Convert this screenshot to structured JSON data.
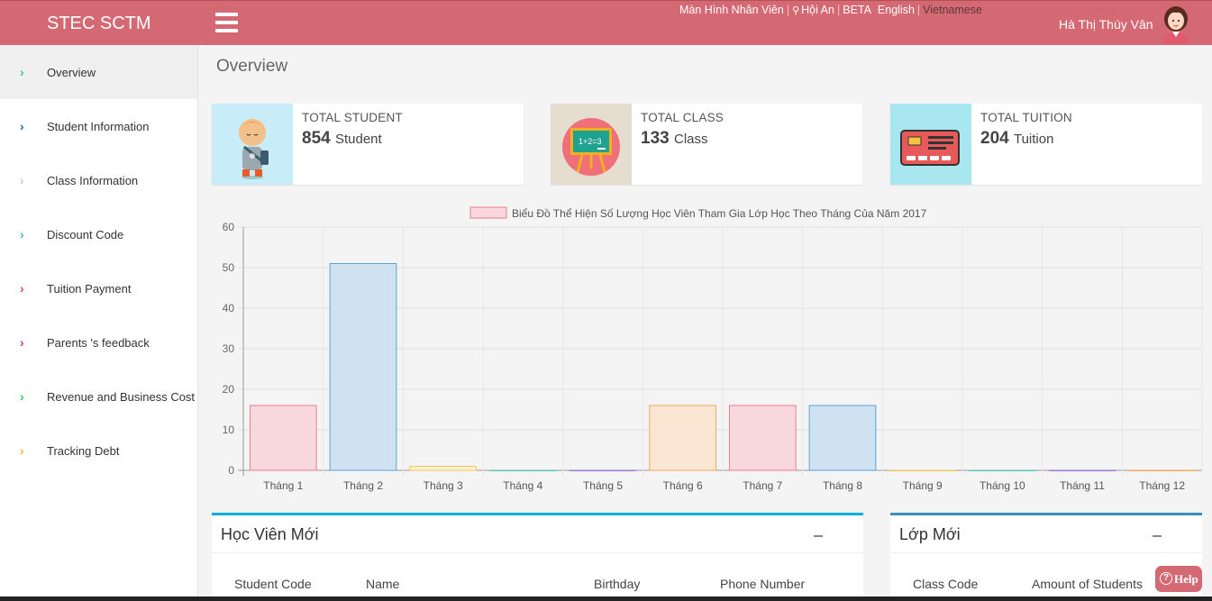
{
  "header": {
    "brand": "STEC SCTM",
    "nav": {
      "screen": "Màn Hình Nhân Viên",
      "location": "Hội An",
      "beta": "BETA",
      "lang_en": "English",
      "lang_vi": "Vietnamese"
    },
    "user_name": "Hà Thị Thúy Vân"
  },
  "sidebar": {
    "items": [
      {
        "label": "Overview",
        "color": "#3bbfb7"
      },
      {
        "label": "Student Information",
        "color": "#2f6fb0"
      },
      {
        "label": "Class Information",
        "color": "#cccccc"
      },
      {
        "label": "Discount Code",
        "color": "#3bbfb7"
      },
      {
        "label": "Tuition Payment",
        "color": "#e0455a"
      },
      {
        "label": "Parents 's feedback",
        "color": "#d6338f"
      },
      {
        "label": "Revenue and Business Cost",
        "color": "#2ecc71"
      },
      {
        "label": "Tracking Debt",
        "color": "#f0c020"
      }
    ]
  },
  "page": {
    "title": "Overview"
  },
  "stats": [
    {
      "label": "TOTAL STUDENT",
      "value": "854",
      "unit": "Student"
    },
    {
      "label": "TOTAL CLASS",
      "value": "133",
      "unit": "Class"
    },
    {
      "label": "TOTAL TUITION",
      "value": "204",
      "unit": "Tuition"
    }
  ],
  "chart_data": {
    "type": "bar",
    "legend": "Biểu Đồ Thể Hiện Số Lượng Học Viên Tham Gia Lớp Học Theo Tháng Của Năm 2017",
    "categories": [
      "Tháng 1",
      "Tháng 2",
      "Tháng 3",
      "Tháng 4",
      "Tháng 5",
      "Tháng 6",
      "Tháng 7",
      "Tháng 8",
      "Tháng 9",
      "Tháng 10",
      "Tháng 11",
      "Tháng 12"
    ],
    "values": [
      16,
      51,
      1,
      0,
      0,
      16,
      16,
      16,
      0,
      0,
      0,
      0
    ],
    "ylim": [
      0,
      60
    ],
    "yticks": [
      0,
      10,
      20,
      30,
      40,
      50,
      60
    ],
    "grid": true,
    "legend_position": "top",
    "colors": [
      {
        "fill": "#f8d7dd",
        "stroke": "#e8808f"
      },
      {
        "fill": "#cfe2f1",
        "stroke": "#5aa2d8"
      },
      {
        "fill": "#fdf2d6",
        "stroke": "#f5c65a"
      },
      {
        "fill": "#d6f1ef",
        "stroke": "#5cc5c0"
      },
      {
        "fill": "#e6dcf6",
        "stroke": "#9c7ad6"
      },
      {
        "fill": "#fbe6d3",
        "stroke": "#f5a95a"
      }
    ]
  },
  "panels": {
    "left": {
      "title": "Học Viên Mới",
      "columns": [
        "Student Code",
        "Name",
        "Birthday",
        "Phone Number"
      ]
    },
    "right": {
      "title": "Lớp Mới",
      "columns": [
        "Class Code",
        "Amount of Students"
      ]
    }
  },
  "help": {
    "label": "Help",
    "icon": "?"
  }
}
